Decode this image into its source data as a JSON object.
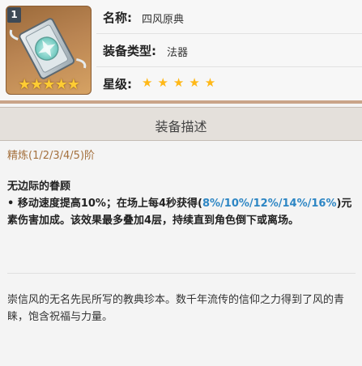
{
  "item": {
    "rank": "1",
    "stars_display": "★★★★★",
    "name_label": "名称:",
    "name_value": "四风原典",
    "type_label": "装备类型:",
    "type_value": "法器",
    "rarity_label": "星级:",
    "rarity_stars": "★★★★★",
    "rarity_count": 5
  },
  "section": {
    "title": "装备描述"
  },
  "refinement": "精炼(1/2/3/4/5)阶",
  "passive": {
    "title": "无边际的眷顾",
    "text_part1": "• 移动速度提高10%；在场上每4秒获得(",
    "highlight": "8%/10%/12%/14%/16%",
    "text_part2": ")元素伤害加成。该效果最多叠加4层，持续直到角色倒下或离场。"
  },
  "lore": "崇信风的无名先民所写的教典珍本。数千年流传的信仰之力得到了风的青睐，饱含祝福与力量。",
  "colors": {
    "highlight": "#2d86c4",
    "refine_text": "#a4703d",
    "star": "#ffb817"
  }
}
